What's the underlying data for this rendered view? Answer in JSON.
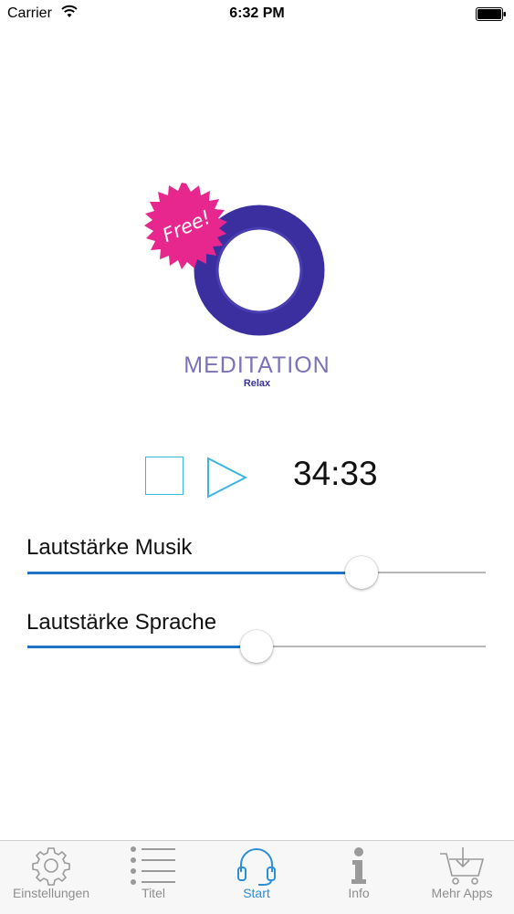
{
  "status_bar": {
    "carrier": "Carrier",
    "time": "6:32 PM"
  },
  "logo": {
    "badge_text": "Free!",
    "title": "MEDITATION",
    "subtitle": "Relax"
  },
  "player": {
    "time": "34:33"
  },
  "sliders": [
    {
      "label": "Lautstärke Musik",
      "level": 0.73
    },
    {
      "label": "Lautstärke Sprache",
      "level": 0.5
    }
  ],
  "tabs": [
    {
      "label": "Einstellungen",
      "icon": "gear-icon",
      "active": false
    },
    {
      "label": "Titel",
      "icon": "list-icon",
      "active": false
    },
    {
      "label": "Start",
      "icon": "headphones-icon",
      "active": true
    },
    {
      "label": "Info",
      "icon": "info-icon",
      "active": false
    },
    {
      "label": "Mehr Apps",
      "icon": "cart-icon",
      "active": false
    }
  ],
  "colors": {
    "accent_blue": "#1e73c8",
    "tab_active": "#2b8ed8",
    "player_cyan": "#3bb6dd",
    "ring_purple": "#3b2fa0",
    "badge_pink": "#e8278e"
  }
}
